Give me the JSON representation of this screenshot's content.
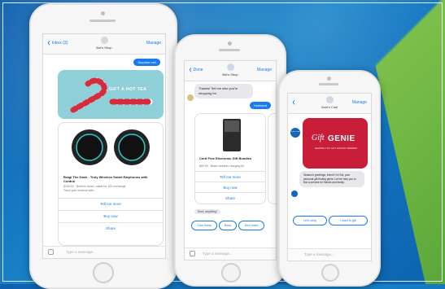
{
  "phone_left": {
    "nav": {
      "back": "❮ Inbox (3)",
      "title": "Bot's Shop",
      "manage": "Manage"
    },
    "surprise_bubble": "Surprise me!",
    "gift_banner": "GIFT A HOT TEA",
    "product": {
      "title": "Bragi The Dash - Truly Wireless Smart Earphones with Control",
      "sub": "$199.00 · Built for music, made for 100 exchange\nTrack your workout with..."
    },
    "buttons": [
      "Tell me more",
      "Buy now",
      "Share"
    ],
    "input_placeholder": "Type a message..."
  },
  "phone_mid": {
    "nav": {
      "back": "❮ Done",
      "title": "Bot's Shop",
      "manage": "Manage"
    },
    "bot_bubble": "Thanks! Tell me who you're shopping for",
    "user_bubble": "Husband",
    "product": {
      "title": "Cord Free Electronic Gift Bundles",
      "sub": "$59.99 · Black wireless charging kit"
    },
    "buttons": [
      "Tell me more",
      "Buy now",
      "Share"
    ],
    "small_bubble": "Sure, anything!",
    "chips": [
      "I love these",
      "Book",
      "Don't want"
    ],
    "input_placeholder": "Type a message..."
  },
  "phone_right": {
    "nav": {
      "back": "❮",
      "title": "Sam's Club",
      "manage": "Manage"
    },
    "logo_label": "Sam's Club",
    "gift_genie": {
      "title_a": "Gift",
      "title_b": "GENIE",
      "tagline": "HELPING YOU GIFT HOLIDAY FRIENDS"
    },
    "bot_text": "Season's greetings, friend! I'm Gini, your personal gift-finding genie. Let me help you to find a present for friends and family.",
    "chips": [
      "Let's shop",
      "I want to gift"
    ],
    "input_placeholder": "Type a message..."
  },
  "colors": {
    "accent": "#1a7bf0",
    "background": "#1372bd",
    "gift_genie_red": "#c81e3a",
    "banner_teal": "#8fcfd8"
  }
}
